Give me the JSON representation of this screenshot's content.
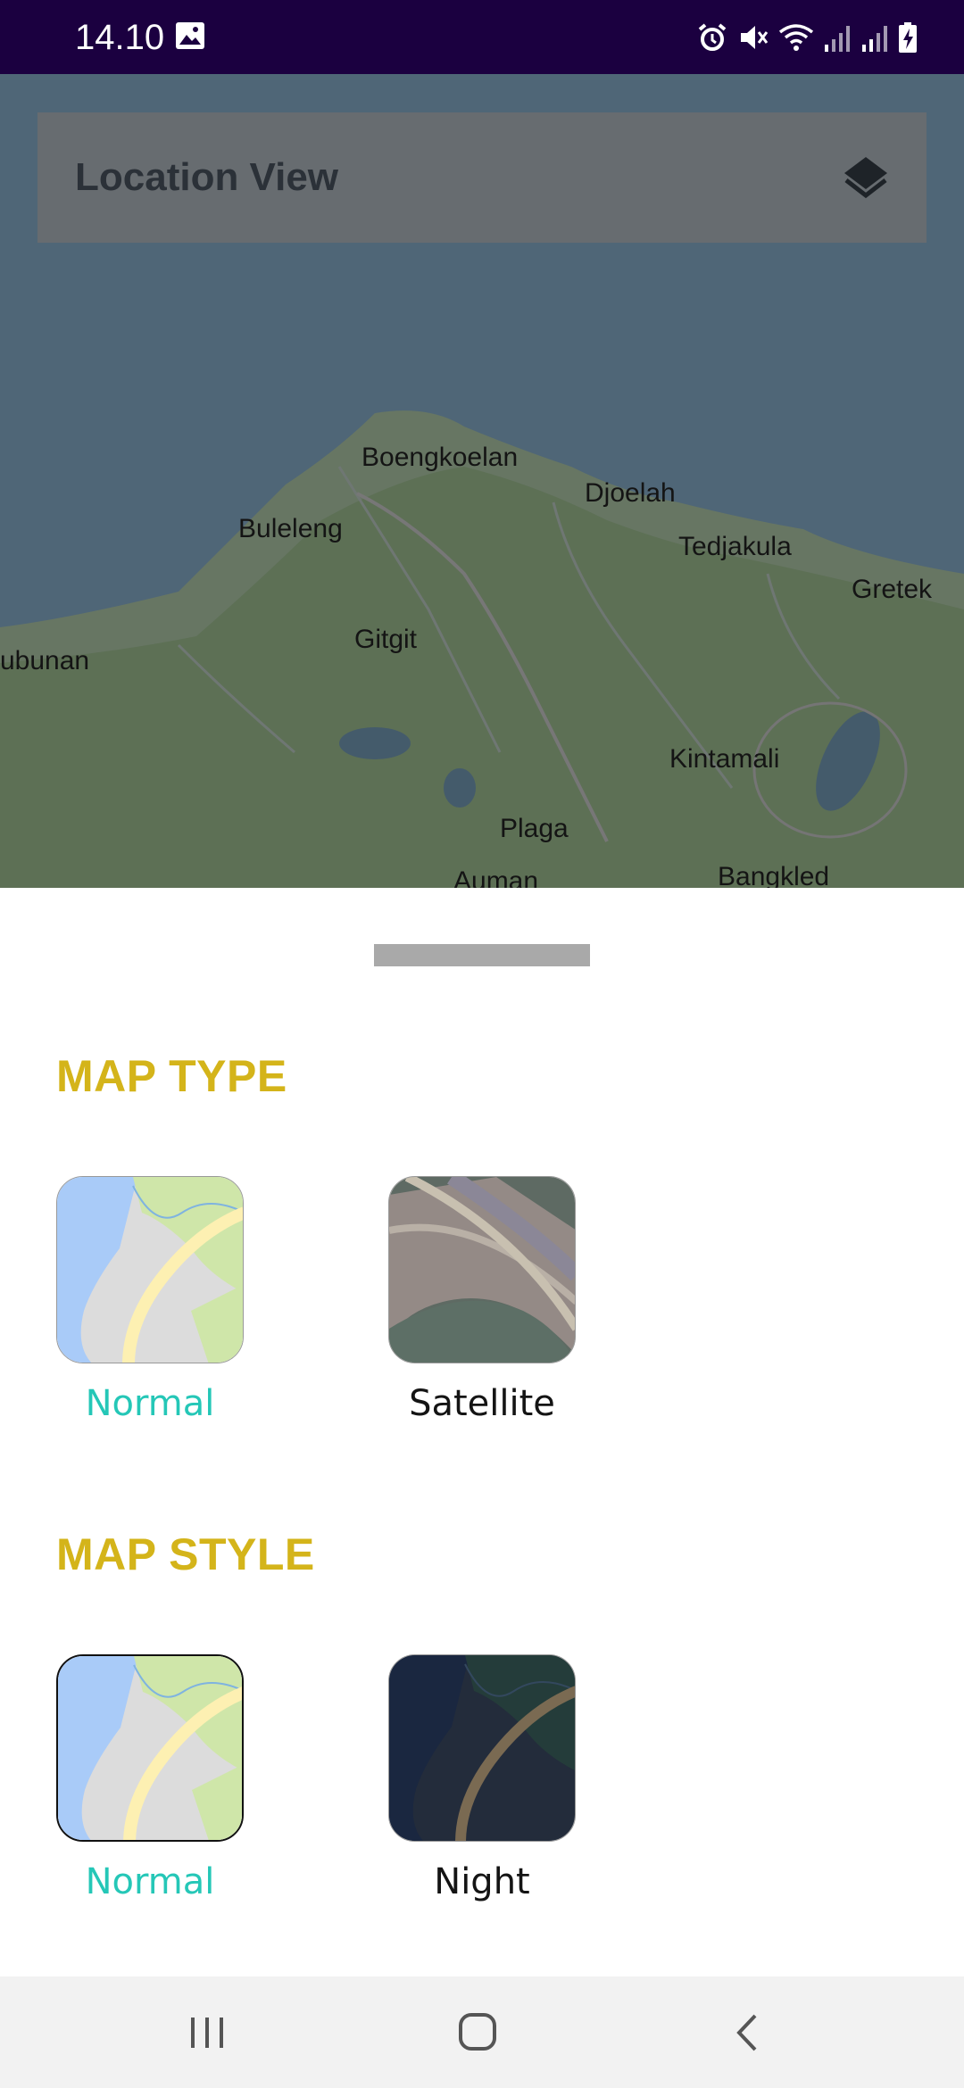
{
  "status_bar": {
    "time": "14.10",
    "icons": [
      "gallery-icon",
      "alarm-icon",
      "mute-icon",
      "wifi-icon",
      "signal-icon",
      "signal-icon",
      "battery-charging-icon"
    ]
  },
  "map": {
    "title": "Location View",
    "layers_icon": "layers-icon",
    "labels": [
      "Boengkoelan",
      "Djoelah",
      "Buleleng",
      "Tedjakula",
      "Gretek",
      "Gitgit",
      "ubunan",
      "Kintamali",
      "Plaga",
      "Auman",
      "Bangkled"
    ]
  },
  "sheet": {
    "map_type": {
      "title": "MAP TYPE",
      "options": [
        {
          "label": "Normal",
          "selected": true
        },
        {
          "label": "Satellite",
          "selected": false
        }
      ]
    },
    "map_style": {
      "title": "MAP STYLE",
      "options": [
        {
          "label": "Normal",
          "selected": true
        },
        {
          "label": "Night",
          "selected": false
        }
      ]
    }
  },
  "colors": {
    "accent_active": "#25c7b7",
    "section_title": "#d4b41a",
    "status_bar_bg": "#1b0040"
  },
  "nav_bar": {
    "icons": [
      "recent-apps-icon",
      "home-icon",
      "back-icon"
    ]
  }
}
